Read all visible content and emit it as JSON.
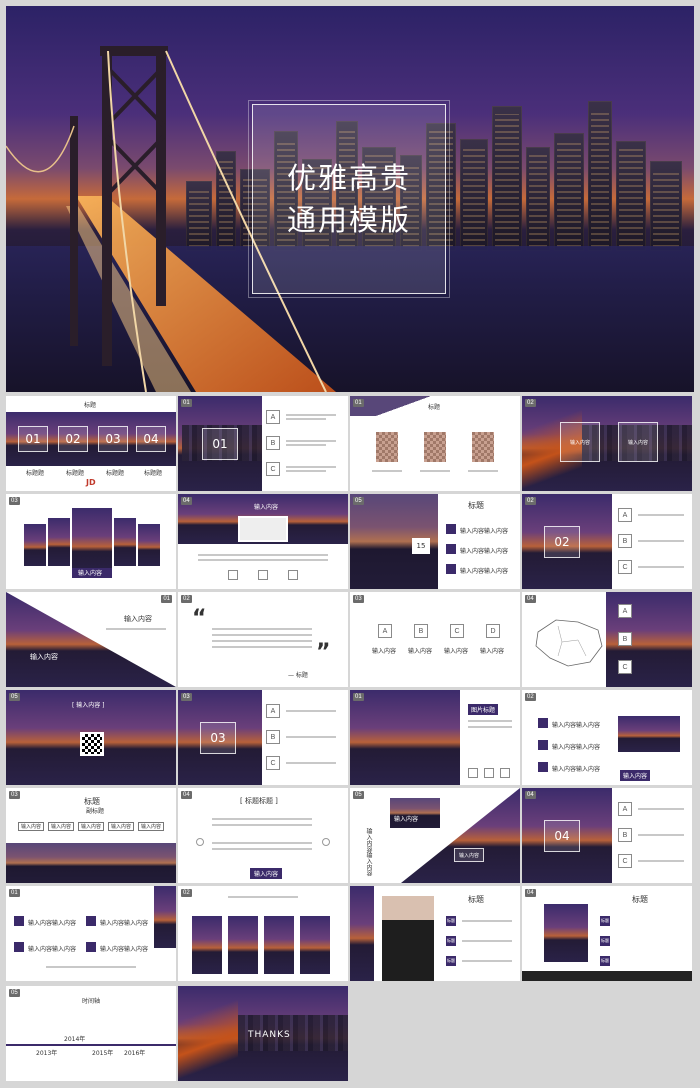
{
  "hero": {
    "title_line1": "优雅高贵",
    "title_line2": "通用模版"
  },
  "slides": {
    "s1": {
      "heading": "标题",
      "items": [
        "01",
        "02",
        "03",
        "04"
      ],
      "labels": [
        "标题题",
        "标题题",
        "标题题",
        "标题题"
      ],
      "logo": "JD"
    },
    "s2": {
      "num": "01",
      "letters": [
        "A",
        "B",
        "C"
      ]
    },
    "s3": {
      "num": "01",
      "heading": "标题"
    },
    "s4": {
      "num": "02",
      "box1": "输入内容",
      "box2": "输入内容"
    },
    "s5": {
      "num": "03",
      "caption": "输入内容"
    },
    "s6": {
      "num": "04",
      "heading": "输入内容"
    },
    "s7": {
      "num": "05",
      "heading": "标题",
      "big": "15",
      "rows": [
        "输入内容输入内容",
        "输入内容输入内容",
        "输入内容输入内容"
      ],
      "tags": [
        "标题",
        "标题",
        "标题"
      ]
    },
    "s8": {
      "num": "02",
      "letters": [
        "A",
        "B",
        "C"
      ]
    },
    "s9": {
      "num": "01",
      "heading": "输入内容",
      "sub": "输入内容"
    },
    "s10": {
      "num": "02",
      "quote_open": "“",
      "quote_close": "”",
      "sign": "— 标题"
    },
    "s11": {
      "num": "03",
      "letters": [
        "A",
        "B",
        "C",
        "D"
      ],
      "labels": [
        "输入内容",
        "输入内容",
        "输入内容",
        "输入内容"
      ]
    },
    "s12": {
      "num": "04",
      "letters": [
        "A",
        "B",
        "C"
      ]
    },
    "s13": {
      "num": "05",
      "heading": "[ 输入内容 ]"
    },
    "s14": {
      "num": "03",
      "letters": [
        "A",
        "B",
        "C"
      ]
    },
    "s15": {
      "num": "01",
      "tag": "图片标题"
    },
    "s16": {
      "num": "02",
      "rows": [
        "输入内容输入内容",
        "输入内容输入内容",
        "输入内容输入内容"
      ],
      "tags": [
        "标题",
        "标题",
        "标题"
      ],
      "caption": "输入内容"
    },
    "s17": {
      "num": "03",
      "heading": "标题",
      "sub": "副标题",
      "buttons": [
        "输入内容",
        "输入内容",
        "输入内容",
        "输入内容",
        "输入内容"
      ]
    },
    "s18": {
      "num": "04",
      "heading": "[ 标题标题 ]",
      "button": "输入内容"
    },
    "s19": {
      "num": "05",
      "heading": "输入内容",
      "side": "输入内容输入内容"
    },
    "s20": {
      "num": "04",
      "letters": [
        "A",
        "B",
        "C"
      ]
    },
    "s21": {
      "num": "01",
      "rows": [
        "输入内容输入内容",
        "输入内容输入内容",
        "输入内容输入内容",
        "输入内容输入内容"
      ],
      "tags": [
        "标题",
        "标题",
        "标题",
        "标题"
      ]
    },
    "s22": {
      "num": "02"
    },
    "s23": {
      "num": "03",
      "heading": "标题",
      "tags": [
        "标题",
        "标题",
        "标题"
      ]
    },
    "s24": {
      "num": "04",
      "heading": "标题",
      "tags": [
        "标题",
        "标题",
        "标题"
      ]
    },
    "s25": {
      "num": "05",
      "heading": "时间轴",
      "years": [
        "2013年",
        "2014年",
        "2015年",
        "2016年"
      ]
    },
    "s26": {
      "thanks": "THANKS"
    }
  },
  "colors": {
    "accent": "#3b2a6a",
    "panel": "#ffffff",
    "bg": "#d6d6d6"
  }
}
